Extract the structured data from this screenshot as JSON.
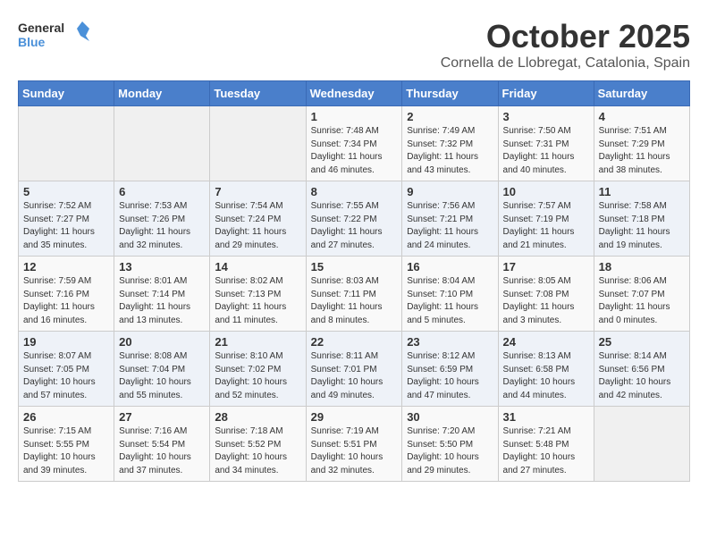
{
  "header": {
    "logo_general": "General",
    "logo_blue": "Blue",
    "month": "October 2025",
    "location": "Cornella de Llobregat, Catalonia, Spain"
  },
  "weekdays": [
    "Sunday",
    "Monday",
    "Tuesday",
    "Wednesday",
    "Thursday",
    "Friday",
    "Saturday"
  ],
  "weeks": [
    [
      {
        "day": "",
        "sunrise": "",
        "sunset": "",
        "daylight": ""
      },
      {
        "day": "",
        "sunrise": "",
        "sunset": "",
        "daylight": ""
      },
      {
        "day": "",
        "sunrise": "",
        "sunset": "",
        "daylight": ""
      },
      {
        "day": "1",
        "sunrise": "Sunrise: 7:48 AM",
        "sunset": "Sunset: 7:34 PM",
        "daylight": "Daylight: 11 hours and 46 minutes."
      },
      {
        "day": "2",
        "sunrise": "Sunrise: 7:49 AM",
        "sunset": "Sunset: 7:32 PM",
        "daylight": "Daylight: 11 hours and 43 minutes."
      },
      {
        "day": "3",
        "sunrise": "Sunrise: 7:50 AM",
        "sunset": "Sunset: 7:31 PM",
        "daylight": "Daylight: 11 hours and 40 minutes."
      },
      {
        "day": "4",
        "sunrise": "Sunrise: 7:51 AM",
        "sunset": "Sunset: 7:29 PM",
        "daylight": "Daylight: 11 hours and 38 minutes."
      }
    ],
    [
      {
        "day": "5",
        "sunrise": "Sunrise: 7:52 AM",
        "sunset": "Sunset: 7:27 PM",
        "daylight": "Daylight: 11 hours and 35 minutes."
      },
      {
        "day": "6",
        "sunrise": "Sunrise: 7:53 AM",
        "sunset": "Sunset: 7:26 PM",
        "daylight": "Daylight: 11 hours and 32 minutes."
      },
      {
        "day": "7",
        "sunrise": "Sunrise: 7:54 AM",
        "sunset": "Sunset: 7:24 PM",
        "daylight": "Daylight: 11 hours and 29 minutes."
      },
      {
        "day": "8",
        "sunrise": "Sunrise: 7:55 AM",
        "sunset": "Sunset: 7:22 PM",
        "daylight": "Daylight: 11 hours and 27 minutes."
      },
      {
        "day": "9",
        "sunrise": "Sunrise: 7:56 AM",
        "sunset": "Sunset: 7:21 PM",
        "daylight": "Daylight: 11 hours and 24 minutes."
      },
      {
        "day": "10",
        "sunrise": "Sunrise: 7:57 AM",
        "sunset": "Sunset: 7:19 PM",
        "daylight": "Daylight: 11 hours and 21 minutes."
      },
      {
        "day": "11",
        "sunrise": "Sunrise: 7:58 AM",
        "sunset": "Sunset: 7:18 PM",
        "daylight": "Daylight: 11 hours and 19 minutes."
      }
    ],
    [
      {
        "day": "12",
        "sunrise": "Sunrise: 7:59 AM",
        "sunset": "Sunset: 7:16 PM",
        "daylight": "Daylight: 11 hours and 16 minutes."
      },
      {
        "day": "13",
        "sunrise": "Sunrise: 8:01 AM",
        "sunset": "Sunset: 7:14 PM",
        "daylight": "Daylight: 11 hours and 13 minutes."
      },
      {
        "day": "14",
        "sunrise": "Sunrise: 8:02 AM",
        "sunset": "Sunset: 7:13 PM",
        "daylight": "Daylight: 11 hours and 11 minutes."
      },
      {
        "day": "15",
        "sunrise": "Sunrise: 8:03 AM",
        "sunset": "Sunset: 7:11 PM",
        "daylight": "Daylight: 11 hours and 8 minutes."
      },
      {
        "day": "16",
        "sunrise": "Sunrise: 8:04 AM",
        "sunset": "Sunset: 7:10 PM",
        "daylight": "Daylight: 11 hours and 5 minutes."
      },
      {
        "day": "17",
        "sunrise": "Sunrise: 8:05 AM",
        "sunset": "Sunset: 7:08 PM",
        "daylight": "Daylight: 11 hours and 3 minutes."
      },
      {
        "day": "18",
        "sunrise": "Sunrise: 8:06 AM",
        "sunset": "Sunset: 7:07 PM",
        "daylight": "Daylight: 11 hours and 0 minutes."
      }
    ],
    [
      {
        "day": "19",
        "sunrise": "Sunrise: 8:07 AM",
        "sunset": "Sunset: 7:05 PM",
        "daylight": "Daylight: 10 hours and 57 minutes."
      },
      {
        "day": "20",
        "sunrise": "Sunrise: 8:08 AM",
        "sunset": "Sunset: 7:04 PM",
        "daylight": "Daylight: 10 hours and 55 minutes."
      },
      {
        "day": "21",
        "sunrise": "Sunrise: 8:10 AM",
        "sunset": "Sunset: 7:02 PM",
        "daylight": "Daylight: 10 hours and 52 minutes."
      },
      {
        "day": "22",
        "sunrise": "Sunrise: 8:11 AM",
        "sunset": "Sunset: 7:01 PM",
        "daylight": "Daylight: 10 hours and 49 minutes."
      },
      {
        "day": "23",
        "sunrise": "Sunrise: 8:12 AM",
        "sunset": "Sunset: 6:59 PM",
        "daylight": "Daylight: 10 hours and 47 minutes."
      },
      {
        "day": "24",
        "sunrise": "Sunrise: 8:13 AM",
        "sunset": "Sunset: 6:58 PM",
        "daylight": "Daylight: 10 hours and 44 minutes."
      },
      {
        "day": "25",
        "sunrise": "Sunrise: 8:14 AM",
        "sunset": "Sunset: 6:56 PM",
        "daylight": "Daylight: 10 hours and 42 minutes."
      }
    ],
    [
      {
        "day": "26",
        "sunrise": "Sunrise: 7:15 AM",
        "sunset": "Sunset: 5:55 PM",
        "daylight": "Daylight: 10 hours and 39 minutes."
      },
      {
        "day": "27",
        "sunrise": "Sunrise: 7:16 AM",
        "sunset": "Sunset: 5:54 PM",
        "daylight": "Daylight: 10 hours and 37 minutes."
      },
      {
        "day": "28",
        "sunrise": "Sunrise: 7:18 AM",
        "sunset": "Sunset: 5:52 PM",
        "daylight": "Daylight: 10 hours and 34 minutes."
      },
      {
        "day": "29",
        "sunrise": "Sunrise: 7:19 AM",
        "sunset": "Sunset: 5:51 PM",
        "daylight": "Daylight: 10 hours and 32 minutes."
      },
      {
        "day": "30",
        "sunrise": "Sunrise: 7:20 AM",
        "sunset": "Sunset: 5:50 PM",
        "daylight": "Daylight: 10 hours and 29 minutes."
      },
      {
        "day": "31",
        "sunrise": "Sunrise: 7:21 AM",
        "sunset": "Sunset: 5:48 PM",
        "daylight": "Daylight: 10 hours and 27 minutes."
      },
      {
        "day": "",
        "sunrise": "",
        "sunset": "",
        "daylight": ""
      }
    ]
  ]
}
